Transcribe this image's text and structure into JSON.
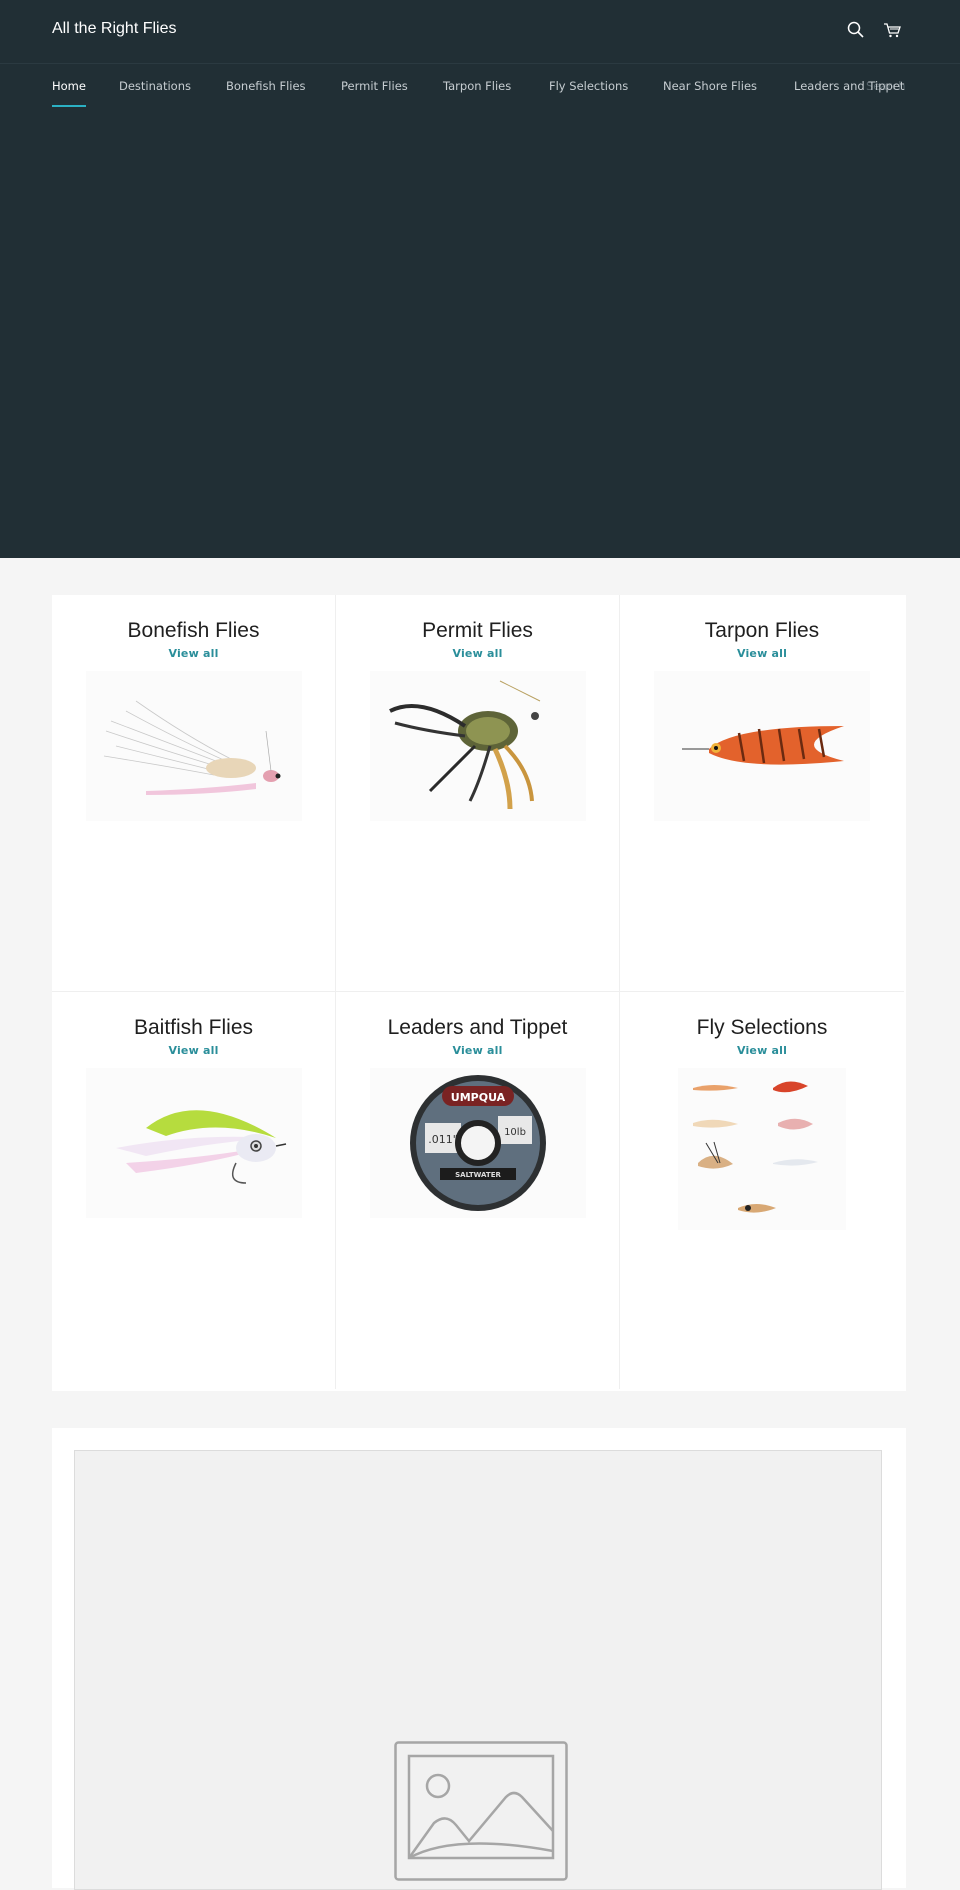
{
  "site": {
    "title": "All the Right Flies"
  },
  "icons": {
    "search": "search-icon",
    "cart": "cart-icon"
  },
  "nav": {
    "items": [
      {
        "label": "Home",
        "active": true
      },
      {
        "label": "Destinations"
      },
      {
        "label": "Bonefish Flies"
      },
      {
        "label": "Permit Flies"
      },
      {
        "label": "Tarpon Flies"
      },
      {
        "label": "Fly Selections"
      },
      {
        "label": "Near Shore Flies"
      },
      {
        "label": "Leaders and Tippet"
      }
    ],
    "ghost": "Search"
  },
  "collections": [
    {
      "title": "Bonefish Flies",
      "link": "View all",
      "image": "bonefish-fly"
    },
    {
      "title": "Permit Flies",
      "link": "View all",
      "image": "permit-fly"
    },
    {
      "title": "Tarpon Flies",
      "link": "View all",
      "image": "tarpon-fly"
    },
    {
      "title": "Baitfish Flies",
      "link": "View all",
      "image": "baitfish-fly"
    },
    {
      "title": "Leaders and Tippet",
      "link": "View all",
      "image": "tippet-spool"
    },
    {
      "title": "Fly Selections",
      "link": "View all",
      "image": "fly-assortment"
    }
  ],
  "spool": {
    "brand": "UMPQUA",
    "size": ".011\"",
    "strength": "10lb",
    "type": "SALTWATER"
  },
  "colors": {
    "header_bg": "#212f35",
    "accent": "#2bb1c4",
    "link": "#2a8e9a"
  }
}
